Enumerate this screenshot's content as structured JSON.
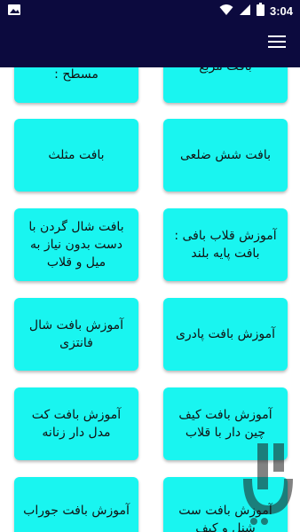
{
  "status": {
    "time": "3:04"
  },
  "icons": {
    "gallery": "image-icon",
    "wifi": "wifi-icon",
    "signal": "signal-icon",
    "battery": "battery-icon",
    "menu": "hamburger-menu-icon"
  },
  "colors": {
    "app_bar": "#0c0a3e",
    "card": "#19f5f0"
  },
  "cards": [
    {
      "label": "بافت مربع"
    },
    {
      "label": "مسطح :"
    },
    {
      "label": "بافت شش ضلعی"
    },
    {
      "label": "بافت مثلث"
    },
    {
      "label": "آموزش قلاب بافی : بافت پایه بلند"
    },
    {
      "label": "بافت شال گردن با دست بدون نیاز به میل و قلاب"
    },
    {
      "label": "آموزش بافت پادری"
    },
    {
      "label": "آموزش بافت شال فانتزی"
    },
    {
      "label": "آموزش بافت کیف چین دار با قلاب"
    },
    {
      "label": "آموزش بافت کت مدل دار زنانه"
    },
    {
      "label": "آموزش بافت ست شنل و کیف"
    },
    {
      "label": "آموزش بافت جوراب"
    }
  ]
}
